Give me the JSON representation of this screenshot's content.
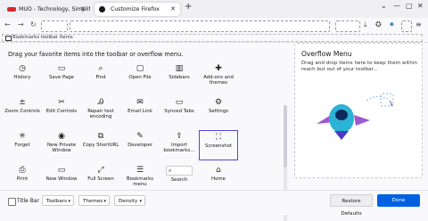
{
  "tabs": [
    {
      "title": "MUO - Technology, Simplified."
    },
    {
      "title": "Customize Firefox"
    }
  ],
  "toolbar": {
    "new_tab": "+",
    "bookmarks_toolbar_label": "Bookmarks toolbar items",
    "window_controls": [
      "—",
      "▢",
      "✕"
    ]
  },
  "main": {
    "intro": "Drag your favorite items into the toolbar or overflow menu."
  },
  "palette": [
    {
      "label": "History",
      "icon": "◷"
    },
    {
      "label": "Save Page",
      "icon": "▭"
    },
    {
      "label": "Find",
      "icon": "⌕"
    },
    {
      "label": "Open File",
      "icon": "▢"
    },
    {
      "label": "Sidebars",
      "icon": "▥"
    },
    {
      "label": "Add-ons and themes",
      "icon": "✚"
    },
    {
      "label": "Zoom Controls",
      "icon": "±"
    },
    {
      "label": "Edit Controls",
      "icon": "✂"
    },
    {
      "label": "Repair text encoding",
      "icon": "Ꭿ"
    },
    {
      "label": "Email Link",
      "icon": "✉"
    },
    {
      "label": "Synced Tabs",
      "icon": "▭"
    },
    {
      "label": "Settings",
      "icon": "⚙"
    },
    {
      "label": "Forget",
      "icon": "✳"
    },
    {
      "label": "New Private Window",
      "icon": "◉"
    },
    {
      "label": "Copy ShortURL",
      "icon": "⧉"
    },
    {
      "label": "Developer",
      "icon": "✎"
    },
    {
      "label": "Import bookmarks…",
      "icon": "⇪"
    },
    {
      "label": "Screenshot",
      "icon": "⛶"
    },
    {
      "label": "Print",
      "icon": "⎙"
    },
    {
      "label": "New Window",
      "icon": "▭"
    },
    {
      "label": "Full Screen",
      "icon": "⤢"
    },
    {
      "label": "Bookmarks menu",
      "icon": "☰"
    },
    {
      "label": "Search",
      "icon": "⌕"
    },
    {
      "label": "Home",
      "icon": "⌂"
    }
  ],
  "overflow": {
    "title": "Overflow Menu",
    "description": "Drag and drop items here to keep them within reach but out of your toolbar…"
  },
  "footer": {
    "title_bar": "Title Bar",
    "toolbars": "Toolbars",
    "themes": "Themes",
    "density": "Density",
    "restore": "Restore Defaults",
    "done": "Done"
  },
  "colors": {
    "accent": "#0061e0",
    "selection": "#5645d8"
  }
}
